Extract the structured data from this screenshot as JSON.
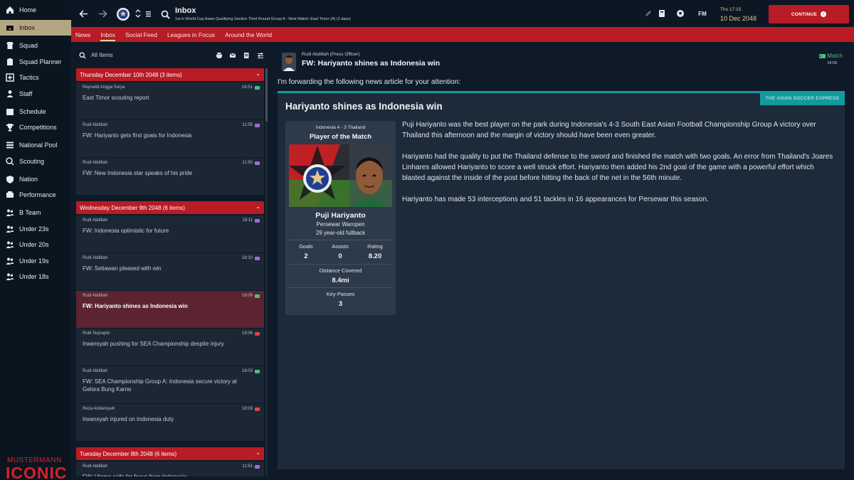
{
  "corner_number": "35",
  "sidebar": {
    "items": [
      {
        "label": "Home",
        "icon": "home-icon"
      },
      {
        "label": "Inbox",
        "icon": "inbox-icon",
        "active": true
      },
      {
        "label": "Squad",
        "icon": "squad-icon"
      },
      {
        "label": "Squad Planner",
        "icon": "clipboard-icon"
      },
      {
        "label": "Tactics",
        "icon": "tactics-icon"
      },
      {
        "label": "Staff",
        "icon": "staff-icon"
      },
      {
        "label": "Schedule",
        "icon": "calendar-icon"
      },
      {
        "label": "Competitions",
        "icon": "trophy-icon"
      },
      {
        "label": "National Pool",
        "icon": "list-icon"
      },
      {
        "label": "Scouting",
        "icon": "search-icon"
      },
      {
        "label": "Nation",
        "icon": "shield-icon"
      },
      {
        "label": "Performance",
        "icon": "performance-icon"
      },
      {
        "label": "B Team",
        "icon": "team-icon"
      },
      {
        "label": "Under 23s",
        "icon": "team-icon"
      },
      {
        "label": "Under 20s",
        "icon": "team-icon"
      },
      {
        "label": "Under 19s",
        "icon": "team-icon"
      },
      {
        "label": "Under 18s",
        "icon": "team-icon"
      }
    ],
    "logo_line1": "MUSTERMANN",
    "logo_line2": "ICONIC"
  },
  "topbar": {
    "title": "Inbox",
    "subtitle": "1st in World Cup Asian Qualifying Section Third Round Group A - Next Match: East Timor (A) (2 days)",
    "brand": "FM",
    "time": "Thu 17:15",
    "date": "10 Dec 2048",
    "continue_label": "CONTINUE"
  },
  "tabs": [
    "News",
    "Inbox",
    "Social Feed",
    "Leagues in Focus",
    "Around the World"
  ],
  "active_tab": "Inbox",
  "list": {
    "filter_label": "All Items",
    "groups": [
      {
        "header": "Thursday December 10th 2048 (3 items)",
        "messages": [
          {
            "from": "Reynaldi Angga Surya",
            "time": "16:51",
            "subject": "East Timor scouting report",
            "tag_color": "#4bbf80"
          },
          {
            "from": "Rudi Abdillah",
            "time": "11:55",
            "subject": "FW: Hariyanto gets first goals for Indonesia",
            "tag_color": "#9c6fd6"
          },
          {
            "from": "Rudi Abdillah",
            "time": "11:50",
            "subject": "FW: New Indonesia star speaks of his pride",
            "tag_color": "#9c6fd6"
          }
        ]
      },
      {
        "header": "Wednesday December 9th 2048 (6 items)",
        "messages": [
          {
            "from": "Rudi Abdillah",
            "time": "18:11",
            "subject": "FW: Indonesia optimistic for future",
            "tag_color": "#9c6fd6"
          },
          {
            "from": "Rudi Abdillah",
            "time": "18:10",
            "subject": "FW: Setiawan pleased with win",
            "tag_color": "#9c6fd6"
          },
          {
            "from": "Rudi Abdillah",
            "time": "18:09",
            "subject": "FW: Hariyanto shines as Indonesia win",
            "tag_color": "#4bbf80",
            "selected": true
          },
          {
            "from": "Robi Suprapto",
            "time": "18:06",
            "subject": "Irwansyah pushing for SEA Championship despite injury",
            "tag_color": "#e04545"
          },
          {
            "from": "Rudi Abdillah",
            "time": "18:03",
            "subject": "FW: SEA Championship Group A: Indonesia secure victory at Gelora Bung Karno",
            "tag_color": "#4bbf80"
          },
          {
            "from": "Reza Ardiansyah",
            "time": "18:03",
            "subject": "Irwansyah injured on Indonesia duty",
            "tag_color": "#e04545"
          }
        ]
      },
      {
        "header": "Tuesday December 8th 2048 (6 items)",
        "messages": [
          {
            "from": "Rudi Abdillah",
            "time": "11:51",
            "subject": "FW: Utomo calls for focus from Indonesia",
            "tag_color": "#9c6fd6"
          }
        ]
      }
    ]
  },
  "detail": {
    "sender": "Rudi Abdillah  (Press Officer)",
    "title": "FW: Hariyanto shines as Indonesia win",
    "type_label": "Match",
    "time": "18:09",
    "intro": "I'm forwarding the following news article for your attention:",
    "publication": "THE ASIAN SOCCER EXPRESS",
    "article_title": "Hariyanto shines as Indonesia win",
    "potm": {
      "score": "Indonesia 4 - 3 Thailand",
      "label": "Player of the Match",
      "name": "Puji Hariyanto",
      "club": "Persewar Waropen",
      "role": "29 year-old fullback",
      "goals_label": "Goals",
      "goals": "2",
      "assists_label": "Assists",
      "assists": "0",
      "rating_label": "Rating",
      "rating": "8.20",
      "distance_label": "Distance Covered",
      "distance": "8.4mi",
      "passes_label": "Key Passes",
      "passes": "3"
    },
    "paragraphs": [
      "Puji Hariyanto was the best player on the park during Indonesia's 4-3 South East Asian Football Championship Group A victory over Thailand this afternoon and the margin of victory should have been even greater.",
      "Hariyanto had the quality to put the Thailand defense to the sword and finished the match with two goals. An error from Thailand's Joares Linhares allowed Hariyanto to score a well struck effort. Hariyanto then added his 2nd goal of the game with a powerful effort which blasted against the inside of the post before hitting the back of the net in the 56th minute.",
      "Hariyanto has made 53 interceptions and 51 tackles in 16 appearances for Persewar this season."
    ]
  }
}
